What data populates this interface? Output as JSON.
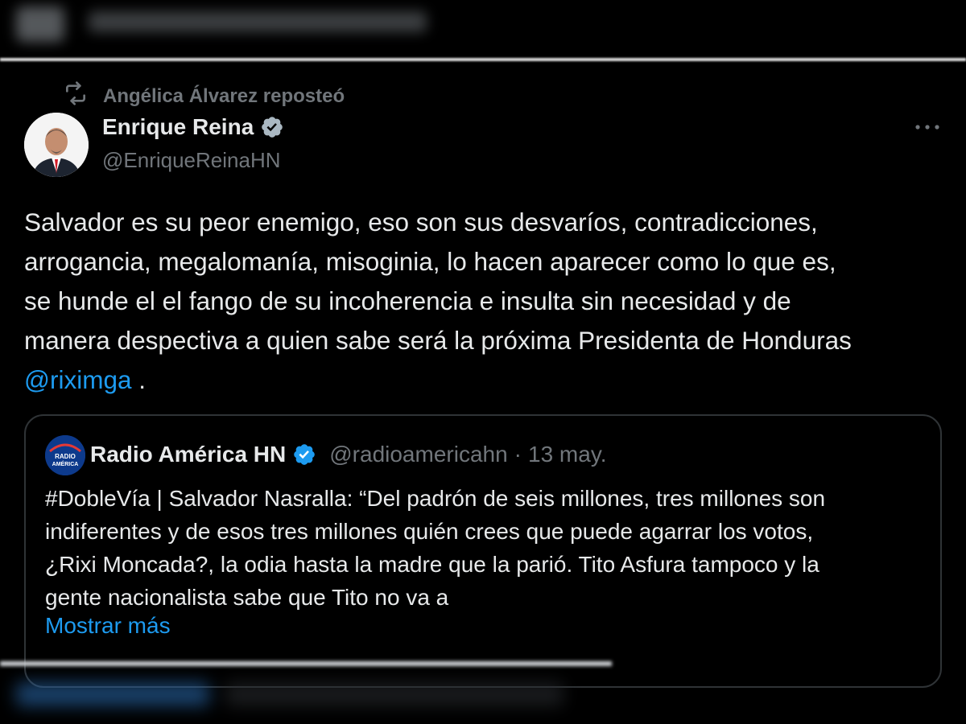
{
  "repost": {
    "icon": "repost-icon",
    "text": "Angélica Álvarez reposteó"
  },
  "author": {
    "name": "Enrique Reina",
    "handle": "@EnriqueReinaHN",
    "verified": true
  },
  "more_icon": "more-options-icon",
  "tweet": {
    "lines": [
      "Salvador es su peor enemigo, eso son sus desvaríos, contradicciones,",
      "arrogancia, megalomanía, misoginia, lo hacen aparecer como lo que es,",
      "se hunde el el fango de su incoherencia e insulta sin necesidad y de",
      "manera despectiva a quien sabe será la próxima Presidenta de Honduras"
    ],
    "mention": "@riximga",
    "trailing": " ."
  },
  "quote": {
    "avatar_text_1": "RADIO",
    "avatar_text_2": "AMÉRICA",
    "name": "Radio América HN",
    "handle": "@radioamericahn",
    "separator": "·",
    "date": "13 may.",
    "lines": [
      "#DobleVía | Salvador Nasralla: “Del padrón de seis millones, tres millones son",
      "indiferentes y de esos tres millones quién crees que puede agarrar los votos,",
      "¿Rixi Moncada?, la odia hasta la madre que la parió. Tito Asfura tampoco y la",
      "gente nacionalista sabe que Tito no va a"
    ],
    "show_more": "Mostrar más"
  },
  "colors": {
    "background": "#000000",
    "text": "#e7e9ea",
    "muted": "#71767b",
    "link": "#1d9bf0",
    "verified": "#1d9bf0",
    "border": "#2f3336"
  }
}
